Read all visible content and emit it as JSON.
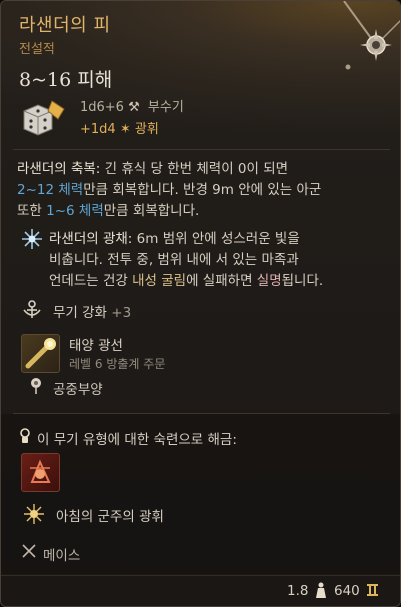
{
  "item": {
    "name": "라샌더의 피",
    "rarity": "전설적",
    "damage_headline": "8~16 피해",
    "damage_dice": "1d6+6",
    "damage_type": "부수기",
    "bonus_damage": "+1d4",
    "bonus_damage_type": "광휘"
  },
  "blessing": {
    "name": "라샌더의 축복:",
    "text_1": " 긴 휴식 당 한번 체력이 0이 되면",
    "heal_amount": "2~12 체력",
    "text_2": "만큼 회복합니다. 반경 9m 안에 있는 아군",
    "text_3": "또한 ",
    "ally_heal": "1~6 체력",
    "text_4": "만큼 회복합니다."
  },
  "radiance": {
    "name": "라샌더의 광채:",
    "text_1": " 6m 범위 안에 성스러운 빛을",
    "text_2": "비춥니다. 전투 중, 범위 내에 서 있는 마족과",
    "text_3": "언데드는 건강 ",
    "term_1": "내성 굴림",
    "text_4": "에 실패하면 ",
    "term_2": "실명",
    "text_5": "됩니다."
  },
  "weapon_enchant": {
    "label": "무기 강화",
    "value": "+3"
  },
  "spell": {
    "name": "태양 광선",
    "sub": "레벨 6 방출계 주문"
  },
  "float": {
    "label": "공중부양"
  },
  "proficiency": {
    "unlock_label": "이 무기 유형에 대한 숙련으로 해금:",
    "action_name": "아침의 군주의 광휘"
  },
  "weapon_type": {
    "label": "메이스"
  },
  "footer": {
    "weight": "1.8",
    "price": "640"
  },
  "colors": {
    "title": "#e0b56a",
    "blue": "#5fa6d6",
    "gold": "#e0b05a"
  }
}
